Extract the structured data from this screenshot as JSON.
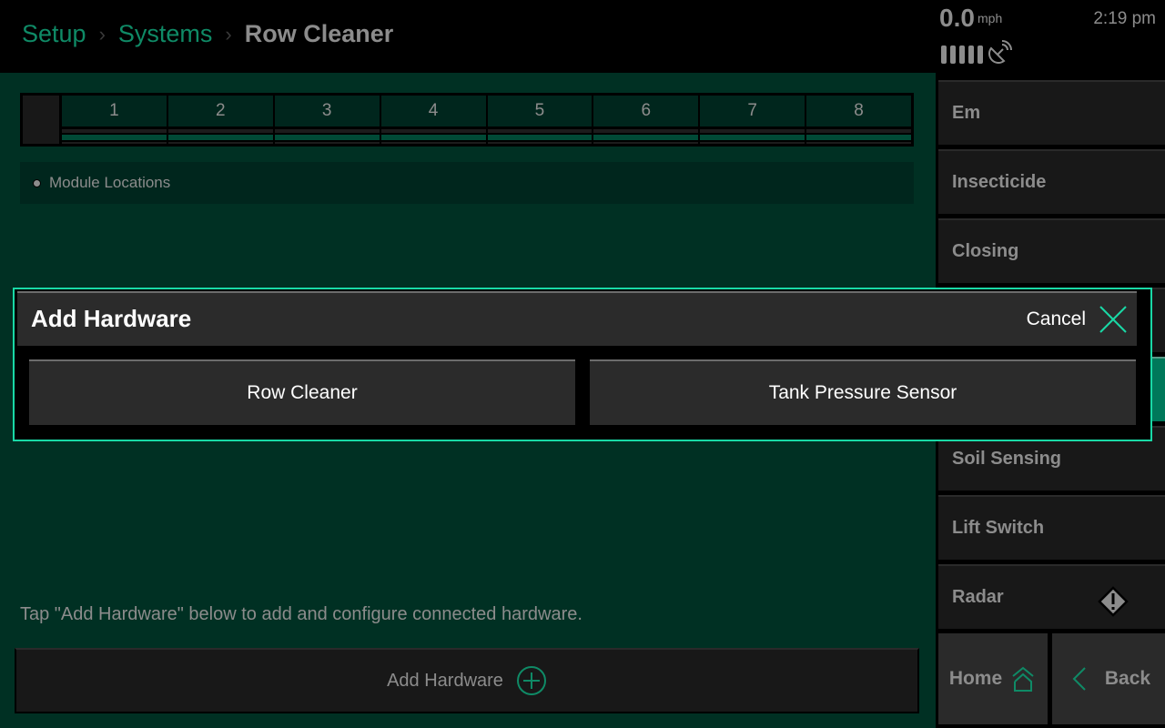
{
  "breadcrumb": {
    "items": [
      "Setup",
      "Systems"
    ],
    "current": "Row Cleaner"
  },
  "status": {
    "speed": "0.0",
    "speed_unit": "mph",
    "time": "2:19 pm",
    "signal_bars": 5,
    "satellite_icon": "satellite-dish-icon"
  },
  "rows": {
    "labels": [
      "1",
      "2",
      "3",
      "4",
      "5",
      "6",
      "7",
      "8"
    ]
  },
  "legend": {
    "label": "Module Locations"
  },
  "hint": "Tap \"Add Hardware\" below to add and configure connected hardware.",
  "add_hardware_button": {
    "label": "Add Hardware",
    "icon": "plus-circle-icon"
  },
  "sidebar": {
    "items": [
      {
        "label": "Em"
      },
      {
        "label": "Insecticide"
      },
      {
        "label": "Closing"
      },
      {
        "label": ""
      },
      {
        "label": ""
      },
      {
        "label": "Soil Sensing"
      },
      {
        "label": "Lift Switch"
      },
      {
        "label": "Radar",
        "warning": true
      }
    ],
    "home_label": "Home",
    "back_label": "Back"
  },
  "modal": {
    "title": "Add Hardware",
    "cancel_label": "Cancel",
    "options": [
      "Row Cleaner",
      "Tank Pressure Sensor"
    ]
  },
  "colors": {
    "accent": "#19d9a6",
    "brand_green": "#0f8a66",
    "background": "#003023",
    "active_item": "#00785a"
  }
}
